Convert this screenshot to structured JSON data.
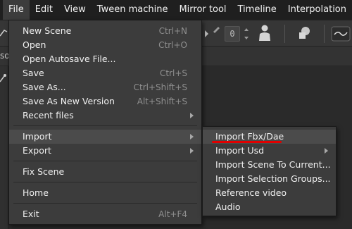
{
  "menubar": {
    "items": [
      "File",
      "Edit",
      "View",
      "Tween machine",
      "Mirror tool",
      "Timeline",
      "Interpolation"
    ],
    "active": "File"
  },
  "toolbar": {
    "field_value": "0"
  },
  "strip": {
    "left_fragment": "so"
  },
  "file_menu": {
    "items": [
      {
        "label": "New Scene",
        "shortcut": "Ctrl+N"
      },
      {
        "label": "Open",
        "shortcut": "Ctrl+O"
      },
      {
        "label": "Open Autosave File...",
        "shortcut": ""
      },
      {
        "label": "Save",
        "shortcut": "Ctrl+S"
      },
      {
        "label": "Save As...",
        "shortcut": "Ctrl+Shift+S"
      },
      {
        "label": "Save As New Version",
        "shortcut": "Alt+Shift+S"
      },
      {
        "label": "Recent files",
        "shortcut": ""
      },
      {
        "label": "Import",
        "shortcut": ""
      },
      {
        "label": "Export",
        "shortcut": ""
      },
      {
        "label": "Fix Scene",
        "shortcut": ""
      },
      {
        "label": "Home",
        "shortcut": ""
      },
      {
        "label": "Exit",
        "shortcut": "Alt+F4"
      }
    ]
  },
  "import_menu": {
    "items": [
      {
        "label": "Import Fbx/Dae"
      },
      {
        "label": "Import Usd"
      },
      {
        "label": "Import Scene To Current..."
      },
      {
        "label": "Import Selection Groups..."
      },
      {
        "label": "Reference video"
      },
      {
        "label": "Audio"
      }
    ]
  },
  "colors": {
    "menu_bg": "#3c3c3c",
    "highlight": "#4b4b4b",
    "annotation": "#e00000"
  }
}
